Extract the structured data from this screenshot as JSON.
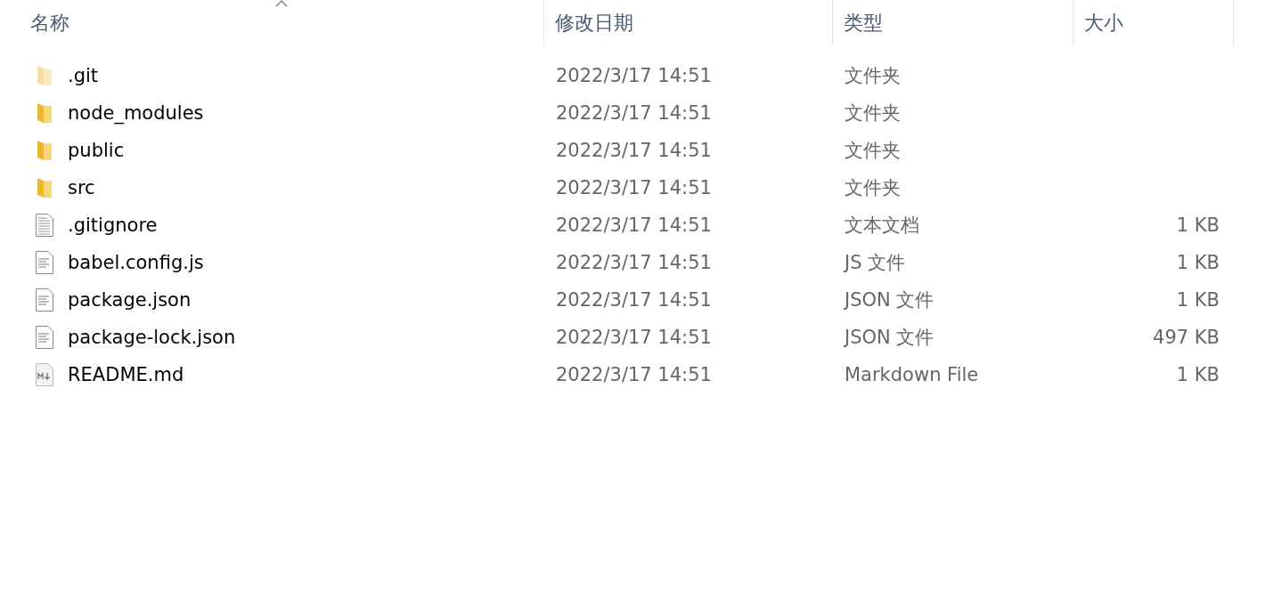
{
  "columns": [
    {
      "label": "名称",
      "sorted": true
    },
    {
      "label": "修改日期",
      "sorted": false
    },
    {
      "label": "类型",
      "sorted": false
    },
    {
      "label": "大小",
      "sorted": false
    }
  ],
  "rows": [
    {
      "name": ".git",
      "kind": "folder",
      "hidden": true,
      "modified": "2022/3/17 14:51",
      "type": "文件夹"
    },
    {
      "name": "node_modules",
      "kind": "folder",
      "hidden": false,
      "modified": "2022/3/17 14:51",
      "type": "文件夹"
    },
    {
      "name": "public",
      "kind": "folder",
      "hidden": false,
      "modified": "2022/3/17 14:51",
      "type": "文件夹"
    },
    {
      "name": "src",
      "kind": "folder",
      "hidden": false,
      "modified": "2022/3/17 14:51",
      "type": "文件夹"
    },
    {
      "name": ".gitignore",
      "kind": "text",
      "hidden": false,
      "modified": "2022/3/17 14:51",
      "type": "文本文档",
      "size": "1 KB"
    },
    {
      "name": "babel.config.js",
      "kind": "file",
      "hidden": false,
      "modified": "2022/3/17 14:51",
      "type": "JS 文件",
      "size": "1 KB"
    },
    {
      "name": "package.json",
      "kind": "file",
      "hidden": false,
      "modified": "2022/3/17 14:51",
      "type": "JSON 文件",
      "size": "1 KB"
    },
    {
      "name": "package-lock.json",
      "kind": "file",
      "hidden": false,
      "modified": "2022/3/17 14:51",
      "type": "JSON 文件",
      "size": "497 KB"
    },
    {
      "name": "README.md",
      "kind": "markdown",
      "hidden": false,
      "modified": "2022/3/17 14:51",
      "type": "Markdown File",
      "size": "1 KB"
    }
  ]
}
